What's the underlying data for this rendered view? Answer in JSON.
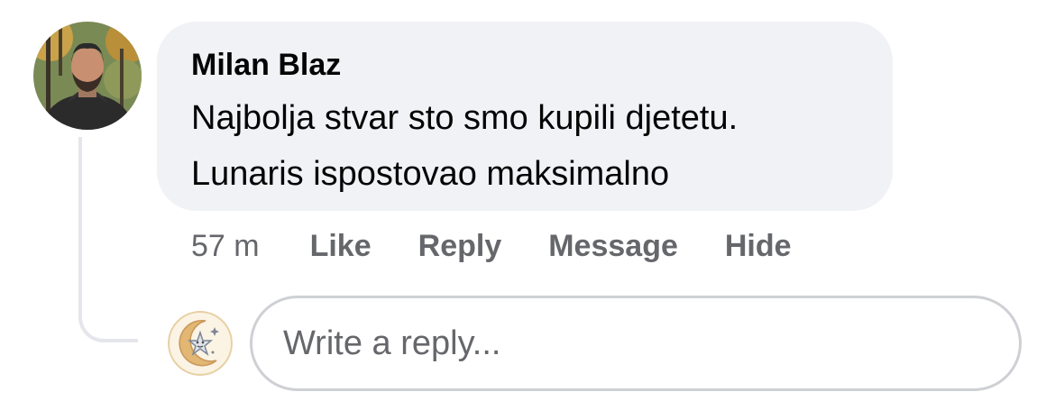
{
  "comment": {
    "author": "Milan Blaz",
    "text_lines": [
      "Najbolja stvar sto smo kupili djetetu.",
      "Lunaris ispostovao maksimalno"
    ],
    "timestamp": "57 m",
    "actions": {
      "like": "Like",
      "reply": "Reply",
      "message": "Message",
      "hide": "Hide"
    }
  },
  "reply": {
    "placeholder": "Write a reply..."
  },
  "icons": {
    "commenter_avatar": "profile-photo",
    "reply_avatar": "moon-star-logo"
  },
  "colors": {
    "bubble_bg": "#f0f2f5",
    "text": "#050505",
    "secondary_text": "#65676b",
    "thread_line": "#e4e6eb",
    "input_border": "#ced0d4"
  }
}
